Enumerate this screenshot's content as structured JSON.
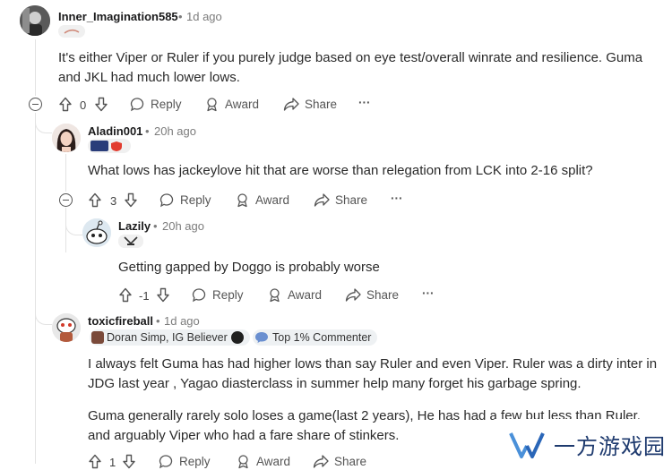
{
  "comments": [
    {
      "username": "Inner_Imagination585",
      "time": "1d ago",
      "body": "It's either Viper or Ruler if you purely judge based on eye test/overall winrate and resilience. Guma and JKL had much lower lows.",
      "score": "0"
    },
    {
      "username": "Aladin001",
      "time": "20h ago",
      "body": "What lows has jackeylove hit that are worse than relegation from LCK into 2-16 split?",
      "score": "3"
    },
    {
      "username": "Lazily",
      "time": "20h ago",
      "body": "Getting gapped by Doggo is probably worse",
      "score": "-1"
    },
    {
      "username": "toxicfireball",
      "time": "1d ago",
      "flair": "Doran Simp, IG Believer",
      "badge": "Top 1% Commenter",
      "body1": "I always felt Guma has had higher lows than say Ruler and even Viper. Ruler was a dirty inter in JDG last year , Yagao diasterclass in summer help many forget his garbage spring.",
      "body2": "Guma generally rarely solo loses a game(last 2 years), He has had a few but less than Ruler, and arguably Viper who had a fare share of stinkers.",
      "score": "1"
    }
  ],
  "actions": {
    "reply": "Reply",
    "award": "Award",
    "share": "Share",
    "more": "···"
  },
  "separator": "•",
  "watermark": "一方游戏园"
}
